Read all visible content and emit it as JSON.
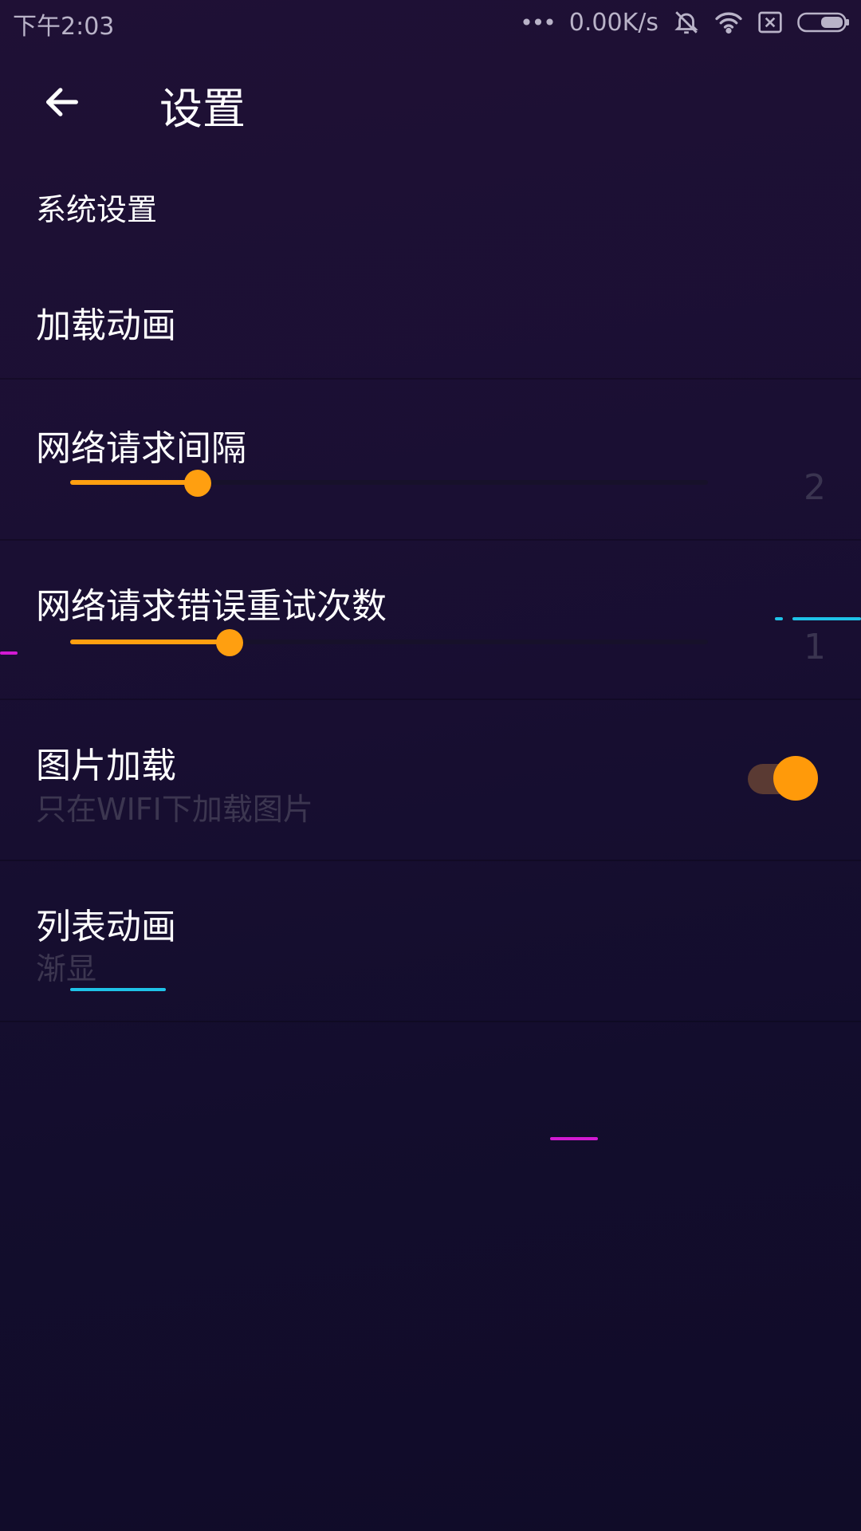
{
  "status_bar": {
    "time": "下午2:03",
    "dots": "•••",
    "net_speed": "0.00K/s",
    "icons": [
      "mute-bell-icon",
      "wifi-icon",
      "sim-x-icon",
      "battery-icon"
    ]
  },
  "app_bar": {
    "back_icon": "arrow-left-icon",
    "title": "设置"
  },
  "section": {
    "title": "系统设置"
  },
  "settings": {
    "load_animation": {
      "title": "加载动画"
    },
    "request_interval": {
      "title": "网络请求间隔",
      "value": "2",
      "fraction": 0.2
    },
    "retry_count": {
      "title": "网络请求错误重试次数",
      "value": "1",
      "fraction": 0.25
    },
    "image_loading": {
      "title": "图片加载",
      "subtitle": "只在WIFI下加载图片",
      "enabled": true
    },
    "list_animation": {
      "title": "列表动画",
      "subtitle": "渐显"
    }
  },
  "colors": {
    "accent": "#ff9f10",
    "deco_cyan": "#1fc3e8",
    "deco_magenta": "#d21ad2"
  }
}
